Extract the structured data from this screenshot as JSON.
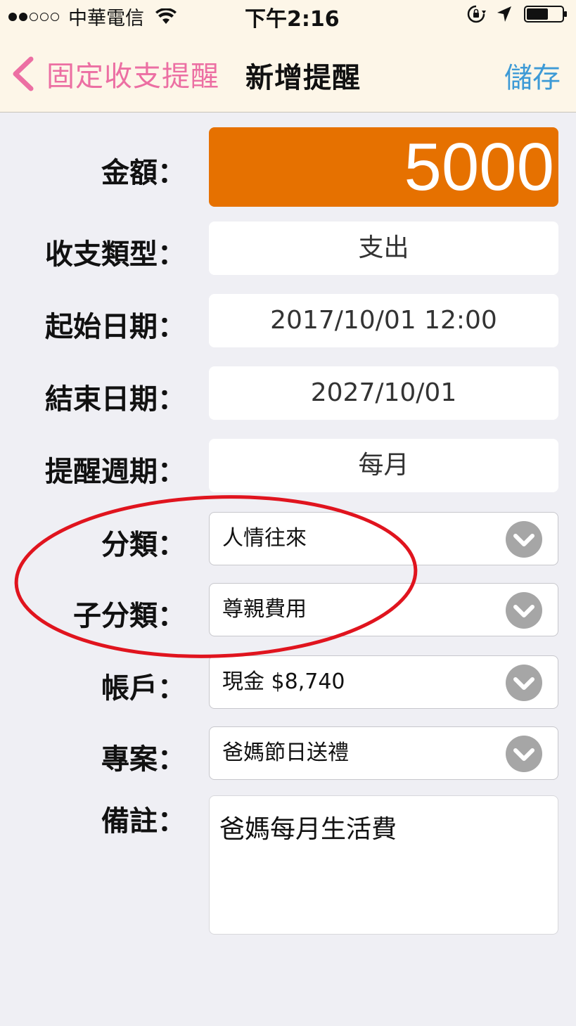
{
  "status_bar": {
    "carrier": "中華電信",
    "time": "下午2:16",
    "signal_icon": "signal-dots-icon",
    "wifi_icon": "wifi-icon",
    "orientation_lock_icon": "orientation-lock-icon",
    "location_icon": "location-arrow-icon",
    "battery_icon": "battery-icon"
  },
  "nav": {
    "back_label": "固定收支提醒",
    "title": "新增提醒",
    "save_label": "儲存",
    "back_color": "#ec6fa3",
    "save_color": "#3d9ad6"
  },
  "form": {
    "amount": {
      "label": "金額：",
      "value": "5000",
      "bg_color": "#e67100"
    },
    "type": {
      "label": "收支類型：",
      "value": "支出"
    },
    "start_date": {
      "label": "起始日期：",
      "value": "2017/10/01 12:00"
    },
    "end_date": {
      "label": "結束日期：",
      "value": "2027/10/01"
    },
    "cycle": {
      "label": "提醒週期：",
      "value": "每月"
    },
    "category": {
      "label": "分類：",
      "value": "人情往來"
    },
    "subcategory": {
      "label": "子分類：",
      "value": "尊親費用"
    },
    "account": {
      "label": "帳戶：",
      "value": "現金 $8,740"
    },
    "project": {
      "label": "專案：",
      "value": "爸媽節日送禮"
    },
    "note": {
      "label": "備註：",
      "value": "爸媽每月生活費"
    }
  },
  "annotation": {
    "shape": "ellipse",
    "color": "#e0141e",
    "highlights": [
      "分類",
      "子分類"
    ]
  }
}
